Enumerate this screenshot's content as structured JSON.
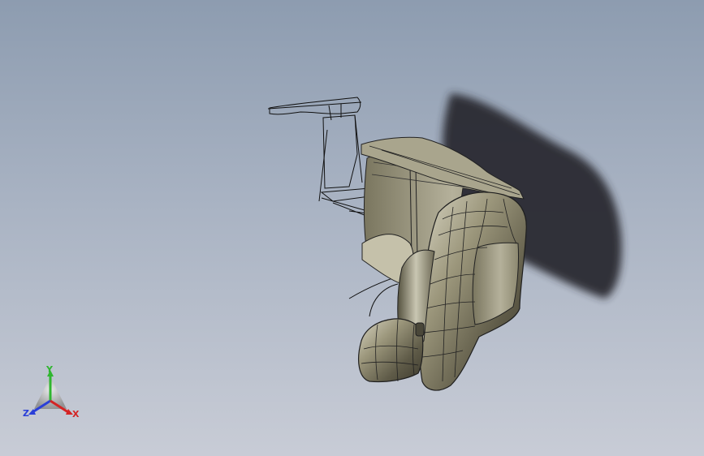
{
  "viewport": {
    "background_top": "#8d9cb0",
    "background_bottom": "#c8ccd6",
    "model_color": "#8f8a70",
    "shadow_color": "#2a2c30"
  },
  "triad": {
    "y_label": "Y",
    "z_label": "Z",
    "x_label": "X",
    "y_color": "#2fb62f",
    "z_color": "#2a3fd8",
    "x_color": "#d42424"
  }
}
